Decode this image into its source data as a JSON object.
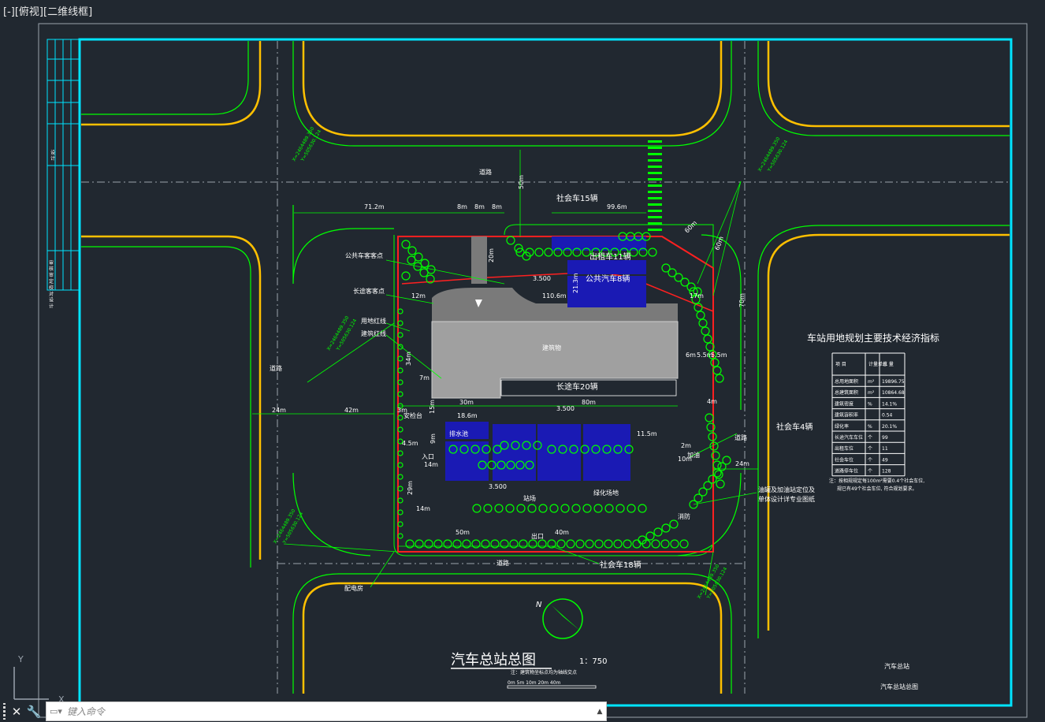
{
  "viewport": {
    "minus": "[-]",
    "view": "[俯视]",
    "style": "[二维线框]"
  },
  "labels": {
    "road": "道路",
    "road_dim_50m": "50m",
    "social_15": "社会车15辆",
    "dim_99_6m": "99.6m",
    "dim_71_2m": "71.2m",
    "dim_8m": "8m",
    "dim_60m": "60m",
    "dim_70m": "70m",
    "dim_20m": "20m",
    "dim_21_3m": "21.3m",
    "dim_110_6m": "110.6m",
    "dim_12m": "12m",
    "dim_17m": "17m",
    "dim_34m": "34m",
    "dim_7m": "7m",
    "dim_30m": "30m",
    "dim_80m": "80m",
    "dim_24m": "24m",
    "dim_42m": "42m",
    "dim_3m": "3m",
    "dim_18_6m": "18.6m",
    "dim_11_5m": "11.5m",
    "dim_15m": "15m",
    "dim_9m": "9m",
    "dim_4_5m": "4.5m",
    "dim_14m": "14m",
    "dim_29m": "29m",
    "dim_10m": "10m",
    "dim_6m": "6m",
    "dim_5_5m": "5.5m",
    "dim_4m": "4m",
    "dim_50m": "50m",
    "dim_40m": "40m",
    "dim_2m": "2m",
    "elev_3500": "3.500",
    "bus_stop": "公共车客客点",
    "long_stop": "长途客客点",
    "land_red": "用地红线",
    "build_red": "建筑红线",
    "taxi_11": "出租车11辆",
    "bus_8": "公共汽车8辆",
    "building": "建筑物",
    "long_20": "长途车20辆",
    "water": "排水池",
    "entrance": "入口",
    "gate": "安检台",
    "social_4": "社会车4辆",
    "refuel": "加油",
    "station": "站场",
    "green": "绿化场地",
    "exit": "出口",
    "hydrant": "消防",
    "power": "配电房",
    "social_18": "社会车18辆",
    "rail": "油罐及加油站定位及",
    "rail2": "单体设计详专业图纸",
    "north": "N",
    "coord_x1": "X=2464489.350",
    "coord_y1": "Y=505630.124"
  },
  "table": {
    "title": "车站用地规划主要技术经济指标",
    "headers": [
      "项 目",
      "计量单位",
      "总 量"
    ],
    "rows": [
      [
        "总用地面积",
        "m²",
        "19896.75"
      ],
      [
        "总建筑面积",
        "m²",
        "10864.68"
      ],
      [
        "建筑密度",
        "%",
        "14.1%"
      ],
      [
        "建筑容积率",
        "",
        "0.54"
      ],
      [
        "绿化率",
        "%",
        "20.1%"
      ],
      [
        "长途汽车车位",
        "个",
        "99"
      ],
      [
        "出租车位",
        "个",
        "11"
      ],
      [
        "社会车位",
        "个",
        "49"
      ],
      [
        "道路停车位",
        "个",
        "128"
      ]
    ],
    "note1": "注：按相规规定每100m²需要0.4个社会车位,",
    "note2": "规已有49个社会车位, 符合规划要求。"
  },
  "title_block": {
    "main_title": "汽车总站总图",
    "scale": "1：750",
    "subnote": "注：建筑物坐标点均为轴线交点",
    "scale_bar": "0m 5m 10m   20m          40m",
    "project": "汽车总站",
    "drawing": "汽车总站总图"
  },
  "side_table": {
    "r1": "设 计",
    "r2": "审 核 审 定 校 对 设 计"
  },
  "ucs": {
    "y": "Y",
    "x": "X"
  },
  "command": {
    "placeholder": "键入命令",
    "close": "✕",
    "settings": "🔧",
    "up": "▲"
  },
  "colors": {
    "bg": "#212830",
    "cyan": "#00e5ff",
    "green": "#00ff00",
    "yellow": "#ffc000",
    "red": "#ff2020",
    "grey": "#9a9a9a",
    "blue": "#1a1ab4",
    "white": "#f2f2f2"
  }
}
